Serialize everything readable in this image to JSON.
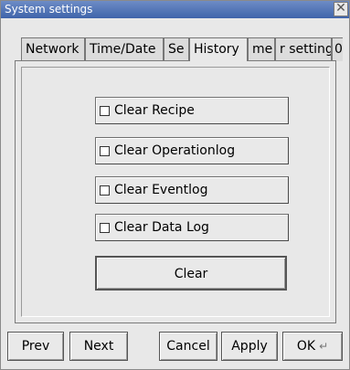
{
  "window": {
    "title": "System settings",
    "close_symbol": "✕"
  },
  "tabs": [
    {
      "label": "Network",
      "active": false
    },
    {
      "label": "Time/Date",
      "active": false
    },
    {
      "label": "Se",
      "active": false
    },
    {
      "label": "History",
      "active": true
    },
    {
      "label": "me",
      "active": false
    },
    {
      "label": "r setting",
      "active": false
    },
    {
      "label": "0",
      "active": false
    }
  ],
  "history": {
    "clear_recipe_label": "Clear Recipe",
    "clear_operationlog_label": "Clear Operationlog",
    "clear_eventlog_label": "Clear Eventlog",
    "clear_datalog_label": "Clear Data Log",
    "clear_recipe_checked": false,
    "clear_operationlog_checked": false,
    "clear_eventlog_checked": false,
    "clear_datalog_checked": false,
    "clear_button_label": "Clear"
  },
  "footer": {
    "prev_label": "Prev",
    "next_label": "Next",
    "cancel_label": "Cancel",
    "apply_label": "Apply",
    "ok_label": "OK",
    "ok_icon": "enter-icon"
  }
}
